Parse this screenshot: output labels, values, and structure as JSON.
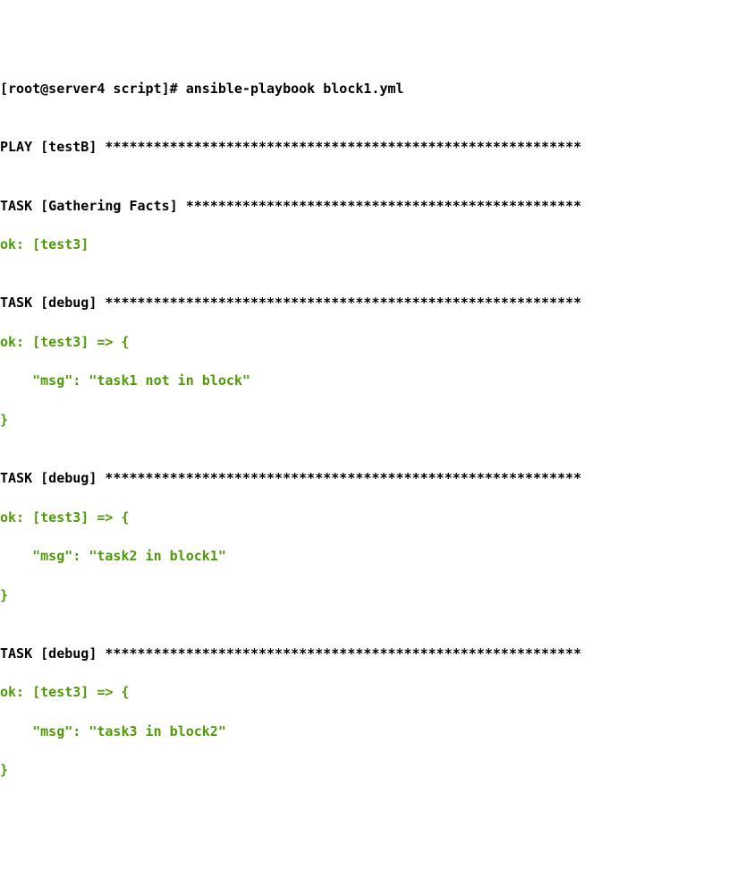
{
  "prompt": "[root@server4 script]# ansible-playbook block1.yml",
  "blank": "",
  "play_header": "PLAY [testB] ***********************************************************",
  "task_gathering": "TASK [Gathering Facts] *************************************************",
  "ok_test3": "ok: [test3]",
  "task_debug": "TASK [debug] ***********************************************************",
  "ok_test3_arrow": "ok: [test3] => {",
  "msg1": "    \"msg\": \"task1 not in block\"",
  "msg2": "    \"msg\": \"task2 in block1\"",
  "msg3": "    \"msg\": \"task3 in block2\"",
  "close_brace": "}"
}
